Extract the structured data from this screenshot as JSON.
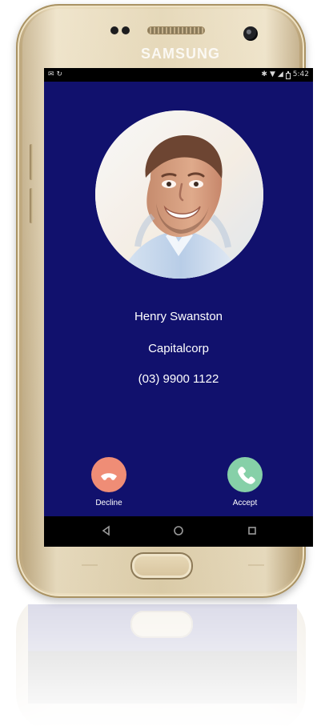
{
  "device": {
    "brand_text": "SAMSUNG",
    "status_bar": {
      "left_icons": [
        "notification-icon",
        "sync-icon"
      ],
      "right_icons": [
        "bluetooth-icon",
        "wifi-icon",
        "signal-icon",
        "battery-icon"
      ],
      "time": "5:42"
    }
  },
  "call": {
    "caller_name": "Henry Swanston",
    "caller_company": "Capitalcorp",
    "caller_phone": "(03) 9900 1122",
    "decline_label": "Decline",
    "accept_label": "Accept"
  },
  "navigation": {
    "icons": [
      "back-icon",
      "home-icon",
      "recents-icon"
    ]
  },
  "colors": {
    "screen_background": "#11116d",
    "decline": "#ef8d76",
    "accept": "#86d0a8",
    "phone_frame": "#e1d1ac"
  }
}
